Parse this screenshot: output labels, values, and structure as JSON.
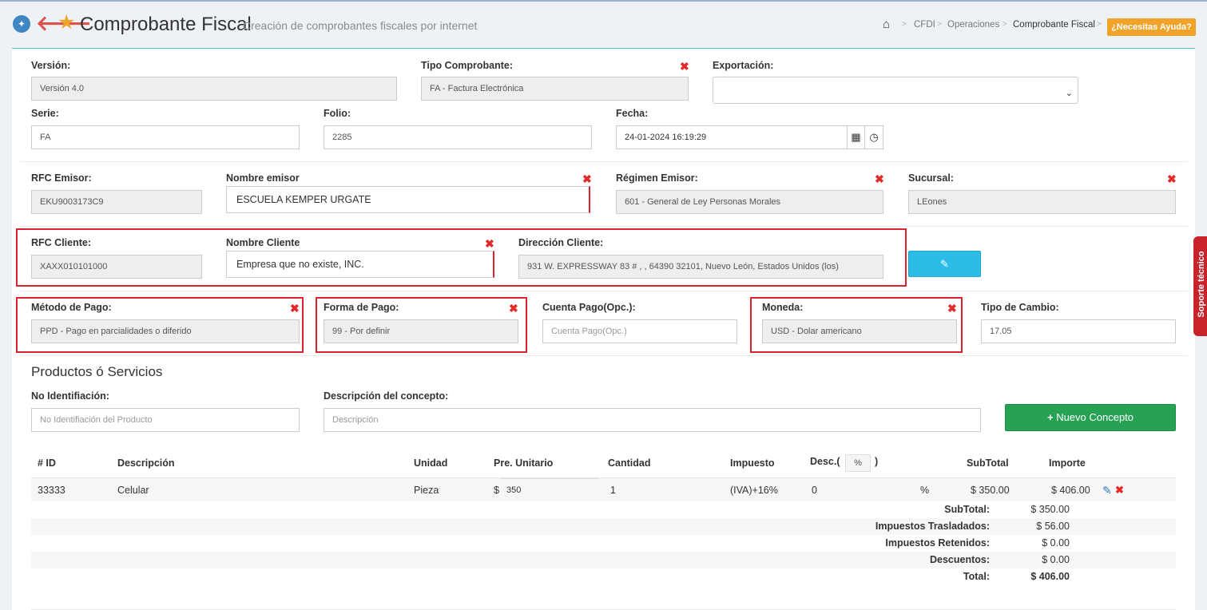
{
  "header": {
    "title": "Comprobante Fiscal",
    "subtitle": "Creación de comprobantes fiscales por internet",
    "breadcrumb": [
      "CFDI",
      "Operaciones",
      "Comprobante Fiscal"
    ],
    "help_label": "¿Necesitas Ayuda?"
  },
  "form": {
    "version": {
      "label": "Versión:",
      "value": "Versión 4.0"
    },
    "tipo_comprobante": {
      "label": "Tipo Comprobante:",
      "value": "FA - Factura Electrónica"
    },
    "exportacion": {
      "label": "Exportación:",
      "value": ""
    },
    "serie": {
      "label": "Serie:",
      "value": "FA"
    },
    "folio": {
      "label": "Folio:",
      "value": "2285"
    },
    "fecha": {
      "label": "Fecha:",
      "value": "24-01-2024 16:19:29"
    },
    "rfc_emisor": {
      "label": "RFC Emisor:",
      "value": "EKU9003173C9"
    },
    "nombre_emisor": {
      "label": "Nombre emisor",
      "value": "ESCUELA KEMPER URGATE"
    },
    "regimen_emisor": {
      "label": "Régimen Emisor:",
      "value": "601 - General de Ley Personas Morales"
    },
    "sucursal": {
      "label": "Sucursal:",
      "value": "LEones"
    },
    "rfc_cliente": {
      "label": "RFC Cliente:",
      "value": "XAXX010101000"
    },
    "nombre_cliente": {
      "label": "Nombre Cliente",
      "value": "Empresa que no existe, INC."
    },
    "direccion_cliente": {
      "label": "Dirección Cliente:",
      "value": "931 W. EXPRESSWAY 83 # , , 64390 32101, Nuevo León, Estados Unidos (los)"
    },
    "metodo_pago": {
      "label": "Método de Pago:",
      "value": "PPD - Pago en parcialidades o diferido"
    },
    "forma_pago": {
      "label": "Forma de Pago:",
      "value": "99 - Por definir"
    },
    "cuenta_pago": {
      "label": "Cuenta Pago(Opc.):",
      "placeholder": "Cuenta Pago(Opc.)"
    },
    "moneda": {
      "label": "Moneda:",
      "value": "USD - Dolar americano"
    },
    "tipo_cambio": {
      "label": "Tipo de Cambio:",
      "value": "17.05"
    }
  },
  "productos": {
    "section_title": "Productos ó Servicios",
    "no_identificacion": {
      "label": "No Identifiación:",
      "placeholder": "No Identifiación del Producto"
    },
    "descripcion": {
      "label": "Descripción del concepto:",
      "placeholder": "Descripción"
    },
    "nuevo_concepto_label": "Nuevo Concepto"
  },
  "table": {
    "headers": {
      "id": "# ID",
      "descripcion": "Descripción",
      "unidad": "Unidad",
      "pre_unitario": "Pre. Unitario",
      "cantidad": "Cantidad",
      "impuesto": "Impuesto",
      "desc_prefix": "Desc.(",
      "desc_pct": "%",
      "desc_suffix": ")",
      "subtotal": "SubTotal",
      "importe": "Importe"
    },
    "rows": [
      {
        "id": "33333",
        "descripcion": "Celular",
        "unidad": "Pieza",
        "currency": "$",
        "pre_unitario": "350",
        "cantidad": "1",
        "impuesto": "(IVA)+16%",
        "desc": "0",
        "desc_pct": "%",
        "subtotal": "$ 350.00",
        "importe": "$ 406.00"
      }
    ]
  },
  "totals": [
    {
      "label": "SubTotal:",
      "value": "$ 350.00"
    },
    {
      "label": "Impuestos Trasladados:",
      "value": "$ 56.00"
    },
    {
      "label": "Impuestos Retenidos:",
      "value": "$ 0.00"
    },
    {
      "label": "Descuentos:",
      "value": "$ 0.00"
    },
    {
      "label": "Total:",
      "value": "$ 406.00"
    }
  ],
  "side_tab": "Soporte técnico",
  "colors": {
    "highlight": "#d9232e",
    "accent_blue": "#2bbde8",
    "accent_green": "#27a254",
    "accent_orange": "#f0a32b",
    "remove_x": "#e32a2a"
  }
}
